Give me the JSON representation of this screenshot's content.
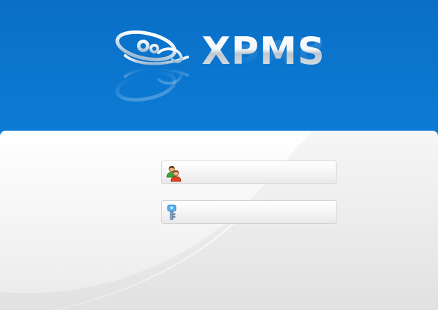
{
  "app": {
    "logo_text": "XPMS",
    "logo_emblem_icon": "xpms-emblem-icon"
  },
  "login": {
    "username": {
      "value": "",
      "placeholder": "",
      "icon": "users-icon"
    },
    "password": {
      "value": "",
      "placeholder": "",
      "icon": "key-icon"
    }
  },
  "colors": {
    "header_background": "#0b78cf",
    "panel_background": "#f4f4f4",
    "field_border": "#d3d3d3"
  }
}
